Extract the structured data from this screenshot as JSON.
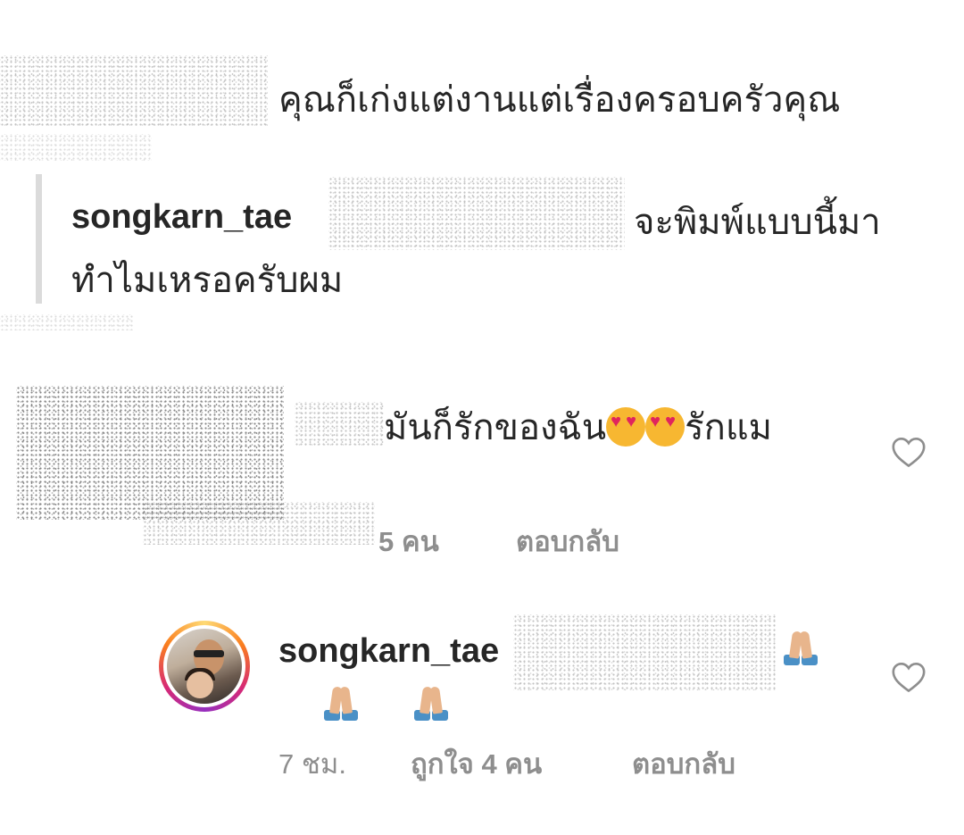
{
  "comments": [
    {
      "text": "คุณก็เก่งแต่งานแต่เรื่องครอบครัวคุณ",
      "reply": {
        "username": "songkarn_tae",
        "text_line1": "จะพิมพ์แบบนี้มา",
        "text_line2": "ทำไมเหรอครับผม"
      }
    },
    {
      "text_before": "มันก็รักของฉัน",
      "text_after": "รักแม",
      "emoji": [
        "heart-eyes",
        "heart-eyes"
      ],
      "likes": "5 คน",
      "reply_label": "ตอบกลับ"
    },
    {
      "username": "songkarn_tae",
      "emoji": [
        "folded-hands",
        "folded-hands",
        "folded-hands"
      ],
      "time": "7 ชม.",
      "likes": "ถูกใจ 4 คน",
      "reply_label": "ตอบกลับ"
    }
  ],
  "icons": {
    "like": "heart-outline-icon",
    "emoji_heart_eyes": "heart-eyes-emoji-icon",
    "emoji_folded_hands": "folded-hands-emoji-icon"
  },
  "colors": {
    "text": "#262626",
    "meta": "#8e8e8e",
    "quote_bar": "#dbdbdb"
  }
}
